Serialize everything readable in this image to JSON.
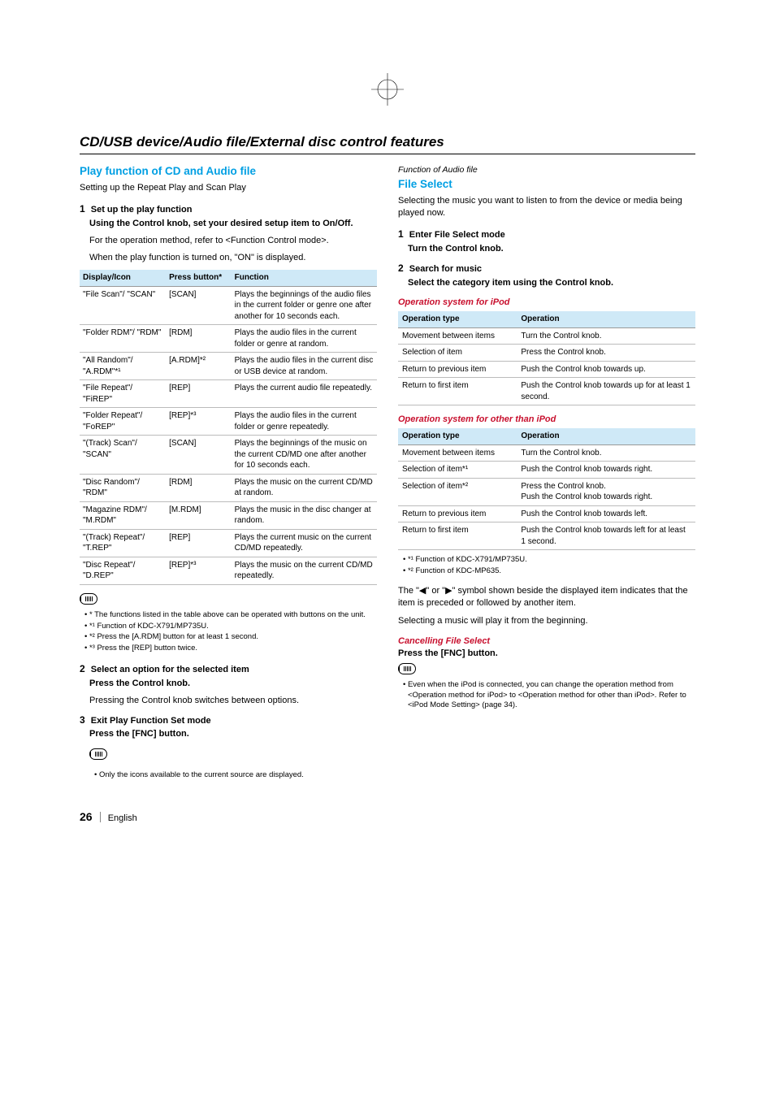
{
  "section_title": "CD/USB device/Audio file/External disc control features",
  "left": {
    "heading": "Play function of CD and Audio file",
    "intro": "Setting up the Repeat Play and Scan Play",
    "step1": {
      "num": "1",
      "title": "Set up the play function",
      "line1": "Using the Control knob, set your desired setup item to On/Off.",
      "line2a": "For the operation method, refer to <Function Control mode>.",
      "line2b": "When the play function is turned on, \"ON\" is displayed."
    },
    "table": {
      "h1": "Display/Icon",
      "h2": "Press button*",
      "h3": "Function",
      "rows": [
        {
          "c1": "\"File Scan\"/ \"SCAN\"",
          "c2": "[SCAN]",
          "c3": "Plays the beginnings of the audio files in the current folder or genre one after another for 10 seconds each."
        },
        {
          "c1": "\"Folder RDM\"/ \"RDM\"",
          "c2": "[RDM]",
          "c3": "Plays the audio files in the current folder or genre at random."
        },
        {
          "c1": "\"All Random\"/ \"A.RDM\"*¹",
          "c2": "[A.RDM]*²",
          "c3": "Plays the audio files in the current disc or USB device at random."
        },
        {
          "c1": "\"File Repeat\"/ \"FiREP\"",
          "c2": "[REP]",
          "c3": "Plays the current audio file repeatedly."
        },
        {
          "c1": "\"Folder Repeat\"/ \"FoREP\"",
          "c2": "[REP]*³",
          "c3": "Plays the audio files in the current folder or genre repeatedly."
        },
        {
          "c1": "\"(Track) Scan\"/ \"SCAN\"",
          "c2": "[SCAN]",
          "c3": "Plays the beginnings of the music on the current CD/MD one after another for 10 seconds each."
        },
        {
          "c1": "\"Disc Random\"/ \"RDM\"",
          "c2": "[RDM]",
          "c3": "Plays the music on the current CD/MD at random."
        },
        {
          "c1": "\"Magazine RDM\"/ \"M.RDM\"",
          "c2": "[M.RDM]",
          "c3": "Plays the music in the disc changer at random."
        },
        {
          "c1": "\"(Track) Repeat\"/ \"T.REP\"",
          "c2": "[REP]",
          "c3": "Plays the current music on the current CD/MD repeatedly."
        },
        {
          "c1": "\"Disc Repeat\"/ \"D.REP\"",
          "c2": "[REP]*³",
          "c3": "Plays the music on the current CD/MD repeatedly."
        }
      ]
    },
    "notes1": [
      "* The functions listed in the table above can be operated with buttons on the unit.",
      "*¹ Function of KDC-X791/MP735U.",
      "*² Press the [A.RDM] button for at least 1 second.",
      "*³ Press the [REP] button twice."
    ],
    "step2": {
      "num": "2",
      "title": "Select an option for the selected item",
      "line1": "Press the Control knob.",
      "line2": "Pressing the Control knob switches between options."
    },
    "step3": {
      "num": "3",
      "title": "Exit Play Function Set mode",
      "line1": "Press the [FNC] button."
    },
    "notes3": [
      "Only the icons available to the current source are displayed."
    ]
  },
  "right": {
    "pretitle": "Function of Audio file",
    "heading": "File Select",
    "intro": "Selecting the music you want to listen to from the device or media being played now.",
    "step1": {
      "num": "1",
      "title": "Enter File Select mode",
      "line1": "Turn the Control knob."
    },
    "step2": {
      "num": "2",
      "title": "Search for music",
      "line1": "Select the category item using the Control knob."
    },
    "opA_head": "Operation system for iPod",
    "opA": {
      "h1": "Operation type",
      "h2": "Operation",
      "rows": [
        {
          "c1": "Movement between items",
          "c2": "Turn the Control knob."
        },
        {
          "c1": "Selection of item",
          "c2": "Press the Control knob."
        },
        {
          "c1": "Return to previous item",
          "c2": "Push the Control knob towards up."
        },
        {
          "c1": "Return to first item",
          "c2": "Push the Control knob towards up for at least 1 second."
        }
      ]
    },
    "opB_head": "Operation system for other than iPod",
    "opB": {
      "h1": "Operation type",
      "h2": "Operation",
      "rows": [
        {
          "c1": "Movement between items",
          "c2": "Turn the Control knob."
        },
        {
          "c1": "Selection of item*¹",
          "c2": "Push the Control knob towards right."
        },
        {
          "c1": "Selection of item*²",
          "c2": "Press the Control knob.\nPush the Control knob towards right."
        },
        {
          "c1": "Return to previous item",
          "c2": "Push the Control knob towards left."
        },
        {
          "c1": "Return to first item",
          "c2": "Push the Control knob towards left for at least 1 second."
        }
      ]
    },
    "notesB": [
      "*¹ Function of KDC-X791/MP735U.",
      "*² Function of KDC-MP635."
    ],
    "para1": "The \"◀\" or \"▶\" symbol shown beside the displayed item indicates that the item is preceded or followed by another item.",
    "para2": "Selecting a music will play it from the beginning.",
    "cancel_head": "Cancelling File Select",
    "cancel_line": "Press the [FNC] button.",
    "notesC": [
      "Even when the iPod is connected, you can change the operation method from <Operation method for iPod> to <Operation method for other than iPod>.  Refer to <iPod Mode Setting> (page 34)."
    ]
  },
  "footer": {
    "page": "26",
    "lang": "English"
  }
}
